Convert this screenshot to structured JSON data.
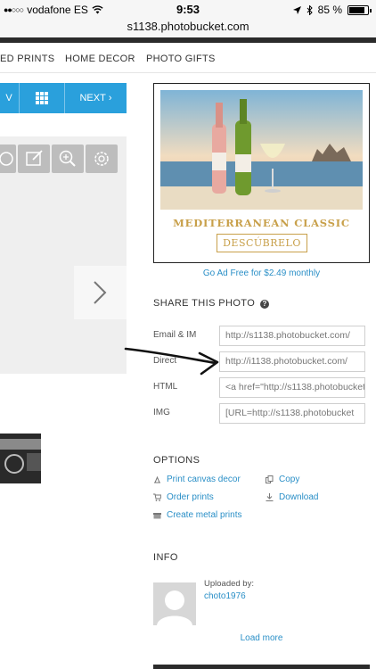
{
  "status_bar": {
    "carrier": "vodafone ES",
    "time": "9:53",
    "battery": "85 %",
    "battery_level": 0.85
  },
  "url_bar": {
    "url": "s1138.photobucket.com"
  },
  "nav": {
    "items": [
      "ED PRINTS",
      "HOME DECOR",
      "PHOTO GIFTS"
    ]
  },
  "photo_toolbar": {
    "prev_label": "V",
    "next_label": "NEXT"
  },
  "ad": {
    "headline": "MEDITERRANEAN CLASSIC",
    "cta": "DESCÚBRELO"
  },
  "ad_free": "Go Ad Free for $2.49 monthly",
  "share": {
    "title": "SHARE THIS PHOTO",
    "rows": [
      {
        "label": "Email & IM",
        "value": "http://s1138.photobucket.com/"
      },
      {
        "label": "Direct",
        "value": "http://i1138.photobucket.com/"
      },
      {
        "label": "HTML",
        "value": "<a href=\"http://s1138.photobucket"
      },
      {
        "label": "IMG",
        "value": "[URL=http://s1138.photobucket"
      }
    ]
  },
  "options": {
    "title": "OPTIONS",
    "items": [
      "Print canvas decor",
      "Copy",
      "Order prints",
      "Download",
      "Create metal prints"
    ]
  },
  "info": {
    "title": "INFO",
    "uploaded_by_label": "Uploaded by:",
    "uploader": "choto1976",
    "load_more": "Load more"
  },
  "colors": {
    "accent": "#2aa0dc",
    "link": "#2a8fc7",
    "gold": "#c8a04a"
  }
}
